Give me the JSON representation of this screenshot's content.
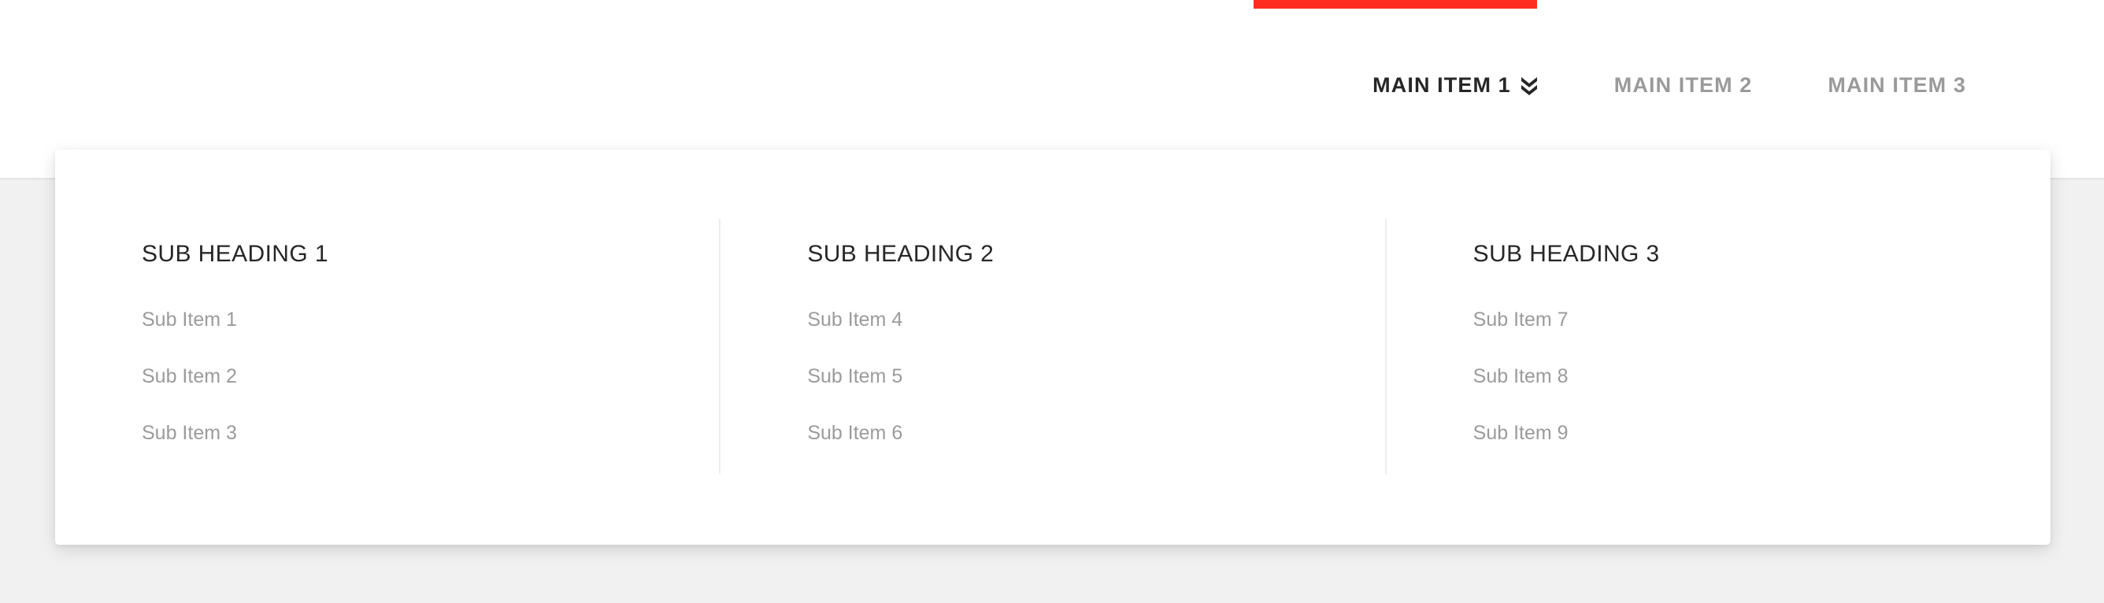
{
  "theme": {
    "accent_color": "#ff2d20",
    "header_background": "#ffffff",
    "page_background": "#f1f1f1",
    "panel_background": "#ffffff",
    "active_nav_color": "#262626",
    "inactive_nav_color": "#9a9a9a",
    "sub_heading_color": "#272727",
    "sub_item_color": "#9b9b9b",
    "divider_color": "#ededed"
  },
  "header": {
    "accent_bar": {
      "name": "accent-bar",
      "color": "#ff2d20"
    },
    "nav": {
      "items": [
        {
          "label": "MAIN ITEM 1",
          "state": "active",
          "has_dropdown": true,
          "caret_icon": "double-chevron-down-icon"
        },
        {
          "label": "MAIN ITEM 2",
          "state": "inactive",
          "has_dropdown": false
        },
        {
          "label": "MAIN ITEM 3",
          "state": "inactive",
          "has_dropdown": false
        }
      ]
    }
  },
  "dropdown": {
    "open": true,
    "parent": "MAIN ITEM 1",
    "columns": [
      {
        "heading": "SUB HEADING 1",
        "items": [
          "Sub Item 1",
          "Sub Item 2",
          "Sub Item 3"
        ]
      },
      {
        "heading": "SUB HEADING 2",
        "items": [
          "Sub Item 4",
          "Sub Item 5",
          "Sub Item 6"
        ]
      },
      {
        "heading": "SUB HEADING 3",
        "items": [
          "Sub Item 7",
          "Sub Item 8",
          "Sub Item 9"
        ]
      }
    ]
  }
}
